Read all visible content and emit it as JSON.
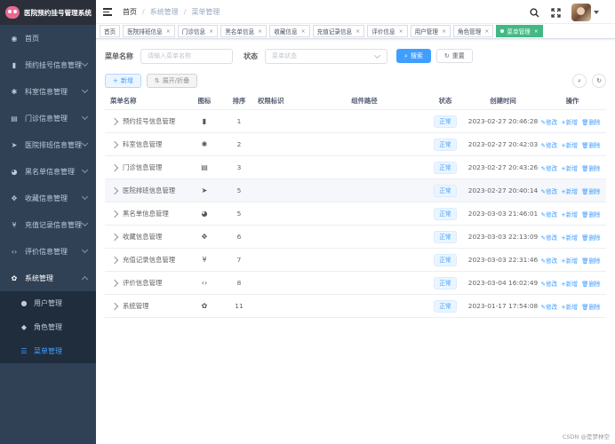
{
  "app": {
    "title": "医院预约挂号管理系统"
  },
  "sidebar": {
    "items": [
      {
        "label": "首页",
        "icon": "◉"
      },
      {
        "label": "预约挂号信息管理",
        "icon": "▮"
      },
      {
        "label": "科室信息管理",
        "icon": "✱"
      },
      {
        "label": "门诊信息管理",
        "icon": "▤"
      },
      {
        "label": "医院排班信息管理",
        "icon": "➤"
      },
      {
        "label": "黑名单信息管理",
        "icon": "◕"
      },
      {
        "label": "收藏信息管理",
        "icon": "✥"
      },
      {
        "label": "充值记录信息管理",
        "icon": "¥"
      },
      {
        "label": "评价信息管理",
        "icon": "‹›"
      },
      {
        "label": "系统管理",
        "icon": "✿"
      }
    ],
    "submenu": [
      {
        "label": "用户管理",
        "icon": "●"
      },
      {
        "label": "角色管理",
        "icon": "◆"
      },
      {
        "label": "菜单管理",
        "icon": "☰"
      }
    ]
  },
  "navbar": {
    "breadcrumb": [
      "首页",
      "系统管理",
      "菜单管理"
    ],
    "separator": "/"
  },
  "tags": [
    {
      "label": "首页",
      "closable": false,
      "active": false
    },
    {
      "label": "医院排班信息",
      "closable": true,
      "active": false
    },
    {
      "label": "门诊信息",
      "closable": true,
      "active": false
    },
    {
      "label": "黑名单信息",
      "closable": true,
      "active": false
    },
    {
      "label": "收藏信息",
      "closable": true,
      "active": false
    },
    {
      "label": "充值记录信息",
      "closable": true,
      "active": false
    },
    {
      "label": "评价信息",
      "closable": true,
      "active": false
    },
    {
      "label": "用户管理",
      "closable": true,
      "active": false
    },
    {
      "label": "角色管理",
      "closable": true,
      "active": false
    },
    {
      "label": "菜单管理",
      "closable": true,
      "active": true
    }
  ],
  "search": {
    "name_label": "菜单名称",
    "name_placeholder": "请输入菜单名称",
    "status_label": "状态",
    "status_placeholder": "菜单状态",
    "search_btn": "搜索",
    "reset_btn": "重置"
  },
  "toolbar": {
    "add_btn": "新增",
    "expand_btn": "展开/折叠"
  },
  "table": {
    "headers": {
      "name": "菜单名称",
      "icon": "图标",
      "order": "排序",
      "perm": "权限标识",
      "path": "组件路径",
      "status": "状态",
      "time": "创建时间",
      "ops": "操作"
    },
    "ops": {
      "edit": "修改",
      "add": "新增",
      "delete": "删除"
    },
    "rows": [
      {
        "name": "预约挂号信息管理",
        "icon": "▮",
        "order": "1",
        "perm": "",
        "path": "",
        "status": "正常",
        "time": "2023-02-27 20:46:28"
      },
      {
        "name": "科室信息管理",
        "icon": "✱",
        "order": "2",
        "perm": "",
        "path": "",
        "status": "正常",
        "time": "2023-02-27 20:42:03"
      },
      {
        "name": "门诊信息管理",
        "icon": "▤",
        "order": "3",
        "perm": "",
        "path": "",
        "status": "正常",
        "time": "2023-02-27 20:43:26"
      },
      {
        "name": "医院排班信息管理",
        "icon": "➤",
        "order": "5",
        "perm": "",
        "path": "",
        "status": "正常",
        "time": "2023-02-27 20:40:14"
      },
      {
        "name": "黑名单信息管理",
        "icon": "◕",
        "order": "5",
        "perm": "",
        "path": "",
        "status": "正常",
        "time": "2023-03-03 21:46:01"
      },
      {
        "name": "收藏信息管理",
        "icon": "✥",
        "order": "6",
        "perm": "",
        "path": "",
        "status": "正常",
        "time": "2023-03-03 22:13:09"
      },
      {
        "name": "充值记录信息管理",
        "icon": "¥",
        "order": "7",
        "perm": "",
        "path": "",
        "status": "正常",
        "time": "2023-03-03 22:31:46"
      },
      {
        "name": "评价信息管理",
        "icon": "‹›",
        "order": "8",
        "perm": "",
        "path": "",
        "status": "正常",
        "time": "2023-03-04 16:02:49"
      },
      {
        "name": "系统管理",
        "icon": "✿",
        "order": "11",
        "perm": "",
        "path": "",
        "status": "正常",
        "time": "2023-01-17 17:54:08"
      }
    ]
  },
  "watermark": "CSDN @是梦林空"
}
